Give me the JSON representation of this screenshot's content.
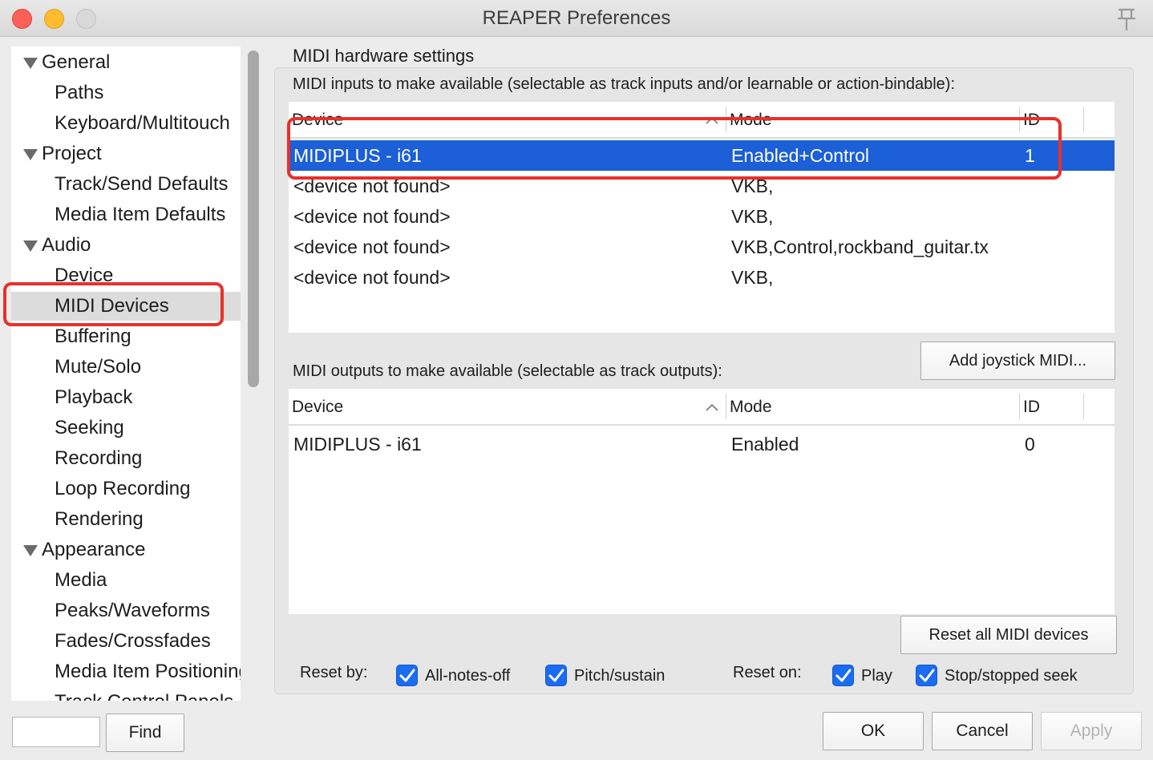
{
  "window": {
    "title": "REAPER Preferences"
  },
  "sidebar": {
    "items": [
      {
        "label": "General",
        "level": 0,
        "expanded": true
      },
      {
        "label": "Paths",
        "level": 1
      },
      {
        "label": "Keyboard/Multitouch",
        "level": 1
      },
      {
        "label": "Project",
        "level": 0,
        "expanded": true
      },
      {
        "label": "Track/Send Defaults",
        "level": 1
      },
      {
        "label": "Media Item Defaults",
        "level": 1
      },
      {
        "label": "Audio",
        "level": 0,
        "expanded": true
      },
      {
        "label": "Device",
        "level": 1
      },
      {
        "label": "MIDI Devices",
        "level": 1,
        "selected": true
      },
      {
        "label": "Buffering",
        "level": 1
      },
      {
        "label": "Mute/Solo",
        "level": 1
      },
      {
        "label": "Playback",
        "level": 1
      },
      {
        "label": "Seeking",
        "level": 1
      },
      {
        "label": "Recording",
        "level": 1
      },
      {
        "label": "Loop Recording",
        "level": 1
      },
      {
        "label": "Rendering",
        "level": 1
      },
      {
        "label": "Appearance",
        "level": 0,
        "expanded": true
      },
      {
        "label": "Media",
        "level": 1
      },
      {
        "label": "Peaks/Waveforms",
        "level": 1
      },
      {
        "label": "Fades/Crossfades",
        "level": 1
      },
      {
        "label": "Media Item Positioning",
        "level": 1
      },
      {
        "label": "Track Control Panels",
        "level": 1
      }
    ],
    "find_value": "",
    "find_button": "Find"
  },
  "main": {
    "section_title": "MIDI hardware settings",
    "inputs": {
      "label": "MIDI inputs to make available (selectable as track inputs and/or learnable or action-bindable):",
      "columns": [
        "Device",
        "Mode",
        "ID"
      ],
      "rows": [
        {
          "device": "MIDIPLUS - i61",
          "mode": "Enabled+Control",
          "id": "1",
          "selected": true
        },
        {
          "device": "<device not found>",
          "mode": "VKB,",
          "id": ""
        },
        {
          "device": "<device not found>",
          "mode": "VKB,",
          "id": ""
        },
        {
          "device": "<device not found>",
          "mode": "VKB,Control,rockband_guitar.tx",
          "id": ""
        },
        {
          "device": "<device not found>",
          "mode": "VKB,",
          "id": ""
        }
      ]
    },
    "add_joystick_button": "Add joystick MIDI...",
    "outputs": {
      "label": "MIDI outputs to make available (selectable as track outputs):",
      "columns": [
        "Device",
        "Mode",
        "ID"
      ],
      "rows": [
        {
          "device": "MIDIPLUS - i61",
          "mode": "Enabled",
          "id": "0"
        }
      ]
    },
    "reset_all_button": "Reset all MIDI devices",
    "reset_by": {
      "label": "Reset by:",
      "all_notes_off": {
        "label": "All-notes-off",
        "checked": true
      },
      "pitch_sustain": {
        "label": "Pitch/sustain",
        "checked": true
      }
    },
    "reset_on": {
      "label": "Reset on:",
      "play": {
        "label": "Play",
        "checked": true
      },
      "stop_seek": {
        "label": "Stop/stopped seek",
        "checked": true
      }
    }
  },
  "footer": {
    "ok": "OK",
    "cancel": "Cancel",
    "apply": "Apply"
  },
  "colors": {
    "selection": "#1c5fd6",
    "checkbox": "#1a6cf1",
    "annotation": "#e8302b"
  }
}
